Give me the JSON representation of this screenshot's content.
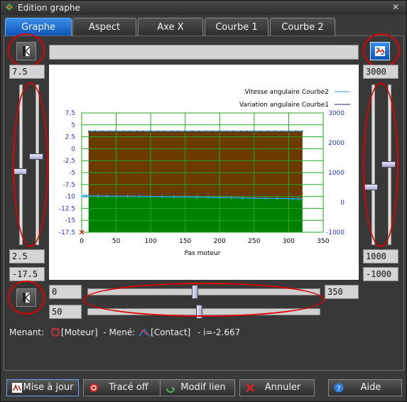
{
  "window": {
    "title": "Edition graphe",
    "close_glyph": "✕"
  },
  "tabs": [
    {
      "label": "Graphe",
      "active": true
    },
    {
      "label": "Aspect",
      "active": false
    },
    {
      "label": "Axe X",
      "active": false
    },
    {
      "label": "Courbe 1",
      "active": false
    },
    {
      "label": "Courbe 2",
      "active": false
    }
  ],
  "left_axis": {
    "max_field": "7.5",
    "low_field": "2.5",
    "min_field": "-17.5",
    "upper_slider": 0.55,
    "lower_slider": 0.45
  },
  "right_axis": {
    "max_field": "3000",
    "low_field": "1000",
    "min_field": "-1000",
    "upper_slider": 0.5,
    "lower_slider": 0.65
  },
  "x_axis": {
    "min_field": "0",
    "max_field": "350",
    "step_field": "50",
    "slider_max": 0.46,
    "slider_step": 0.48
  },
  "top_field": "",
  "status": {
    "menant_label": "Menant:",
    "menant_value": "[Moteur]",
    "mene_label": "- Mené:",
    "mene_value": "[Contact]",
    "ratio": "- i=-2.667"
  },
  "buttons": {
    "update": "Mise à jour",
    "trace": "Tracé off",
    "modif": "Modif lien",
    "cancel": "Annuler",
    "help": "Aide"
  },
  "icons": {
    "app": "app-icon",
    "close": "close-icon",
    "left_axis": "axis-left-icon",
    "right_axis": "axis-swap-icon",
    "x_axis": "axis-x-icon",
    "motor": "motor-icon",
    "contact": "contact-icon"
  },
  "colors": {
    "accent": "#1565d6",
    "highlight_ring": "#e00000",
    "fill_top": "#6b3a00",
    "fill_bottom": "#008000",
    "grid": "#22aa22",
    "curve2": "#2aa1e0",
    "curve1": "#1a237e",
    "left_axis_text": "#2233cc"
  },
  "chart_data": {
    "type": "area",
    "xlabel": "Pas moteur",
    "x_ticks": [
      0,
      50,
      100,
      150,
      200,
      250,
      300,
      350
    ],
    "y_left_ticks": [
      7.5,
      5,
      2.5,
      0,
      -2.5,
      -5,
      -7.5,
      -10,
      -12.5,
      -15,
      -17.5
    ],
    "y_right_ticks": [
      3000,
      2000,
      1000,
      0,
      -1000
    ],
    "xlim": [
      0,
      350
    ],
    "ylim_left": [
      -17.5,
      7.5
    ],
    "ylim_right": [
      -1000,
      3000
    ],
    "grid": true,
    "legend_position": "top-right",
    "series": [
      {
        "name": "Vitesse angulaire Courbe2",
        "axis": "left",
        "x": [
          10,
          320
        ],
        "y": [
          3.7,
          3.7
        ]
      },
      {
        "name": "Variation angulaire Courbe1",
        "axis": "left",
        "x": [
          0,
          10,
          50,
          100,
          150,
          200,
          250,
          300,
          320
        ],
        "y": [
          -9.9,
          -9.9,
          -9.95,
          -10.0,
          -10.1,
          -10.2,
          -10.35,
          -10.45,
          -10.5
        ]
      }
    ]
  }
}
